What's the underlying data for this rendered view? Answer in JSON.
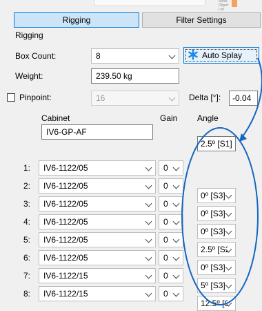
{
  "tabs": [
    {
      "label": "Rigging",
      "selected": true
    },
    {
      "label": "Filter Settings",
      "selected": false
    }
  ],
  "window_caption": "Show Object List",
  "group_label": "Rigging",
  "box_count": {
    "label": "Box Count:",
    "value": "8"
  },
  "auto_splay": {
    "label": "Auto Splay",
    "icon": "asterisk-icon"
  },
  "weight": {
    "label": "Weight:",
    "value": "239.50 kg"
  },
  "pinpoint": {
    "label": "Pinpoint:",
    "value": "16",
    "checked": false
  },
  "delta": {
    "label": "Delta [°]:",
    "value": "-0.04"
  },
  "columns": {
    "cabinet": "Cabinet",
    "gain": "Gain",
    "angle": "Angle"
  },
  "top_cabinet": "IV6-GP-AF",
  "top_angle": "2.5º [S1]",
  "rows": [
    {
      "num": "1:",
      "cabinet": "IV6-1122/05",
      "gain": "0",
      "angle": ""
    },
    {
      "num": "2:",
      "cabinet": "IV6-1122/05",
      "gain": "0",
      "angle": "0º [S3]"
    },
    {
      "num": "3:",
      "cabinet": "IV6-1122/05",
      "gain": "0",
      "angle": "0º [S3]"
    },
    {
      "num": "4:",
      "cabinet": "IV6-1122/05",
      "gain": "0",
      "angle": "0º [S3]"
    },
    {
      "num": "5:",
      "cabinet": "IV6-1122/05",
      "gain": "0",
      "angle": "2.5º [S2"
    },
    {
      "num": "6:",
      "cabinet": "IV6-1122/05",
      "gain": "0",
      "angle": "0º [S3]"
    },
    {
      "num": "7:",
      "cabinet": "IV6-1122/15",
      "gain": "0",
      "angle": "5º [S3]"
    },
    {
      "num": "8:",
      "cabinet": "IV6-1122/15",
      "gain": "0",
      "angle": "12.5º [S"
    }
  ],
  "colors": {
    "accent": "#0078d7",
    "annotation": "#1565c0",
    "tab_selected": "#cce4f7"
  }
}
